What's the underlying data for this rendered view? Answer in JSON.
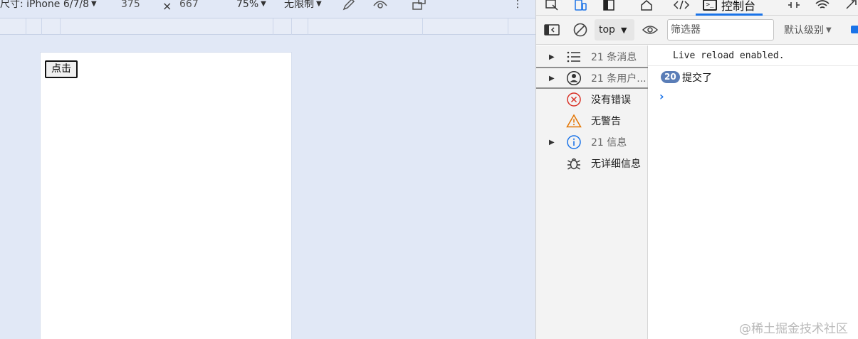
{
  "device_toolbar": {
    "dimensions_label": "尺寸: iPhone 6/7/8",
    "width_value": "375",
    "times_symbol": "×",
    "height_value": "667",
    "zoom": "75%",
    "throttle": "无限制",
    "more_symbol": "⋮"
  },
  "page": {
    "button_label": "点击"
  },
  "devtools": {
    "console_tab_label": "控制台",
    "toolbar": {
      "context": "top",
      "filter_placeholder": "筛选器",
      "levels_label": "默认级别"
    },
    "sidebar": [
      {
        "label": "21 条消息",
        "icon": "list-icon",
        "expandable": true
      },
      {
        "label": "21 条用户...",
        "icon": "user-icon",
        "expandable": true
      },
      {
        "label": "没有错误",
        "icon": "error-icon",
        "expandable": false
      },
      {
        "label": "无警告",
        "icon": "warning-icon",
        "expandable": false
      },
      {
        "label": "21 信息",
        "icon": "info-icon",
        "expandable": true
      },
      {
        "label": "无详细信息",
        "icon": "bug-icon",
        "expandable": false
      }
    ],
    "console": {
      "line1": "Live reload enabled.",
      "repeat_count": "20",
      "line2": "提交了",
      "prompt": "›"
    }
  },
  "watermark": "@稀土掘金技术社区",
  "colors": {
    "accent": "#1a73e8",
    "badge": "#5a7db7",
    "error": "#d93025",
    "warning": "#e37400",
    "info": "#1a73e8"
  }
}
